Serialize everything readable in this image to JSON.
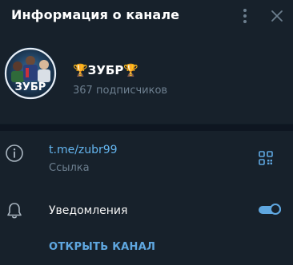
{
  "header": {
    "title": "Информация о канале",
    "menu_icon": "more-vertical-icon",
    "close_icon": "close-icon"
  },
  "channel": {
    "avatar_text": "ЗУБР",
    "name": "🏆ЗУБР🏆",
    "subscribers": "367 подписчиков"
  },
  "link_row": {
    "icon": "info-icon",
    "value": "t.me/zubr99",
    "label": "Ссылка",
    "qr_icon": "qr-code-icon"
  },
  "notifications": {
    "icon": "bell-icon",
    "label": "Уведомления",
    "enabled": true
  },
  "action": {
    "open_channel": "ОТКРЫТЬ КАНАЛ"
  },
  "colors": {
    "background": "#17212b",
    "accent": "#5fa7e0",
    "link": "#64b5ef",
    "muted_text": "#6d7f8f",
    "divider": "#0e1621"
  }
}
